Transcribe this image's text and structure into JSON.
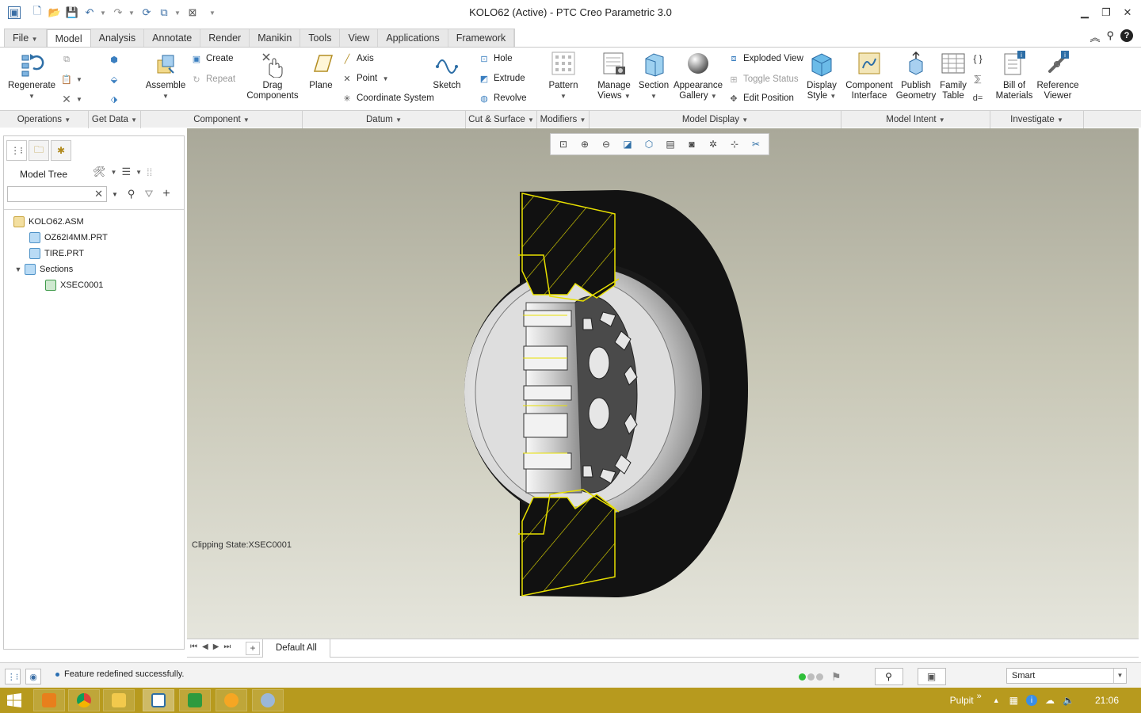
{
  "window": {
    "title": "KOLO62 (Active) - PTC Creo Parametric 3.0"
  },
  "ribbon_tabs": [
    {
      "label": "File",
      "has_dropdown": true
    },
    {
      "label": "Model",
      "active": true
    },
    {
      "label": "Analysis"
    },
    {
      "label": "Annotate"
    },
    {
      "label": "Render"
    },
    {
      "label": "Manikin"
    },
    {
      "label": "Tools"
    },
    {
      "label": "View"
    },
    {
      "label": "Applications"
    },
    {
      "label": "Framework"
    }
  ],
  "ribbon": {
    "regenerate": "Regenerate",
    "assemble": "Assemble",
    "create": "Create",
    "repeat": "Repeat",
    "drag_components_1": "Drag",
    "drag_components_2": "Components",
    "plane": "Plane",
    "axis": "Axis",
    "point": "Point",
    "coordinate_system": "Coordinate System",
    "sketch": "Sketch",
    "hole": "Hole",
    "extrude": "Extrude",
    "revolve": "Revolve",
    "pattern": "Pattern",
    "manage_views_1": "Manage",
    "manage_views_2": "Views",
    "section": "Section",
    "appearance_gallery_1": "Appearance",
    "appearance_gallery_2": "Gallery",
    "exploded_view": "Exploded View",
    "toggle_status": "Toggle Status",
    "edit_position": "Edit Position",
    "display_style_1": "Display",
    "display_style_2": "Style",
    "component_interface_1": "Component",
    "component_interface_2": "Interface",
    "publish_geometry_1": "Publish",
    "publish_geometry_2": "Geometry",
    "family_table_1": "Family",
    "family_table_2": "Table",
    "bill_of_materials_1": "Bill of",
    "bill_of_materials_2": "Materials",
    "reference_viewer_1": "Reference",
    "reference_viewer_2": "Viewer"
  },
  "groups": [
    {
      "label": "Operations"
    },
    {
      "label": "Get Data"
    },
    {
      "label": "Component"
    },
    {
      "label": "Datum"
    },
    {
      "label": "Cut & Surface"
    },
    {
      "label": "Modifiers"
    },
    {
      "label": "Model Display"
    },
    {
      "label": "Model Intent"
    },
    {
      "label": "Investigate"
    }
  ],
  "model_tree": {
    "label": "Model Tree",
    "search_value": "",
    "items": [
      {
        "label": "KOLO62.ASM",
        "type": "assembly"
      },
      {
        "label": "OZ62I4MM.PRT",
        "type": "part"
      },
      {
        "label": "TIRE.PRT",
        "type": "part"
      },
      {
        "label": "Sections",
        "type": "folder",
        "expanded": true
      },
      {
        "label": "XSEC0001",
        "type": "section"
      }
    ]
  },
  "viewport": {
    "clipping_state": "Clipping State:XSEC0001",
    "toolbar_icons": [
      "refit-icon",
      "zoom-in-icon",
      "zoom-out-icon",
      "repaint-icon",
      "display-style-icon",
      "saved-orientations-icon",
      "view-manager-icon",
      "datum-display-icon",
      "spin-center-icon",
      "annotation-display-icon"
    ]
  },
  "view_tabs": {
    "default": "Default All"
  },
  "status": {
    "message": "Feature redefined successfully.",
    "filter": "Smart",
    "led_colors": [
      "#2fbf3a",
      "#bdbdbd",
      "#bdbdbd"
    ]
  },
  "taskbar": {
    "tray_label": "Pulpit",
    "tray_chevron": "»",
    "clock": "21:06"
  }
}
